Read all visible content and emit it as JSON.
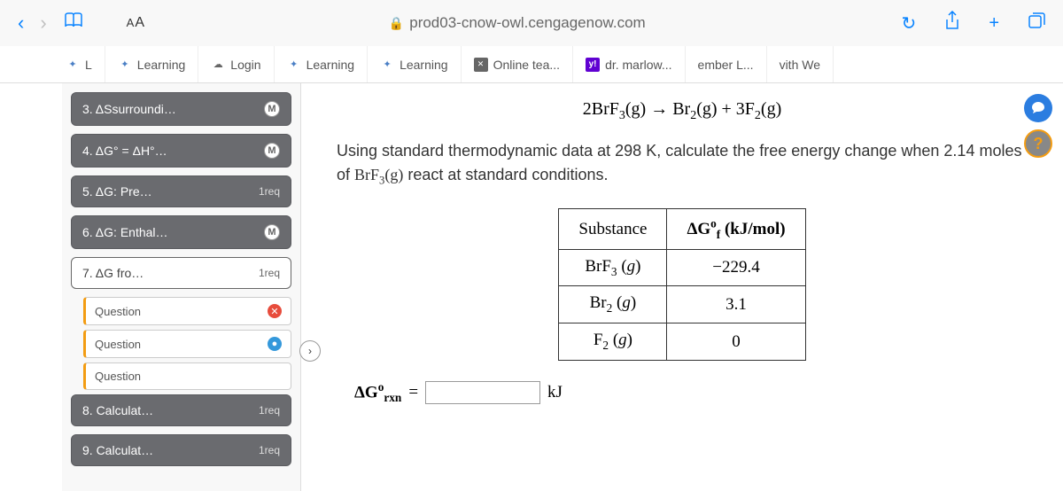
{
  "browser": {
    "url": "prod03-cnow-owl.cengagenow.com",
    "textSize": "AA"
  },
  "tabs": [
    {
      "label": "L",
      "fav": "owl"
    },
    {
      "label": "Learning",
      "fav": "owl"
    },
    {
      "label": "Login",
      "fav": "cloud"
    },
    {
      "label": "Learning",
      "fav": "owl"
    },
    {
      "label": "Learning",
      "fav": "owl"
    },
    {
      "label": "Online tea...",
      "fav": "x"
    },
    {
      "label": "dr. marlow...",
      "fav": "y"
    },
    {
      "label": "ember L...",
      "fav": ""
    },
    {
      "label": "vith We",
      "fav": ""
    }
  ],
  "sidebar": {
    "items": [
      {
        "label": "3. ΔSsurroundi…",
        "badge": "M",
        "style": "dark"
      },
      {
        "label": "4. ΔG° = ΔH°…",
        "badge": "M",
        "style": "dark"
      },
      {
        "label": "5. ΔG: Pre…",
        "badge": "1req",
        "style": "dark"
      },
      {
        "label": "6. ΔG: Enthal…",
        "badge": "M",
        "style": "dark"
      },
      {
        "label": "7. ΔG fro…",
        "badge": "1req",
        "style": "current"
      },
      {
        "label": "8. Calculat…",
        "badge": "1req",
        "style": "dark"
      },
      {
        "label": "9. Calculat…",
        "badge": "1req",
        "style": "dark"
      }
    ],
    "subItems": [
      {
        "label": "Question",
        "badge": "red"
      },
      {
        "label": "Question",
        "badge": "blue"
      },
      {
        "label": "Question",
        "badge": ""
      }
    ]
  },
  "problem": {
    "equationParts": {
      "lhs_coef": "2",
      "lhs_species": "BrF",
      "lhs_sub": "3",
      "arrow": "→",
      "rhs1_species": "Br",
      "rhs1_sub": "2",
      "plus": "+",
      "rhs2_coef": "3",
      "rhs2_species": "F",
      "rhs2_sub": "2",
      "phase": "(g)"
    },
    "textBefore": "Using standard thermodynamic data at 298 K, calculate the free energy change when 2.14 moles of ",
    "textSpecies": "BrF",
    "textSpeciesSub": "3",
    "textPhase": "(g)",
    "textAfter": " react at standard conditions.",
    "tableHeaders": {
      "substance": "Substance",
      "deltaG": "ΔG",
      "deltaGSup": "o",
      "deltaGSub": "f",
      "units": "(kJ/mol)"
    },
    "answerLabel": {
      "symbol": "ΔG",
      "sup": "o",
      "sub": "rxn",
      "equals": "=",
      "unit": "kJ"
    }
  },
  "chart_data": {
    "type": "table",
    "title": "Standard Gibbs free energy of formation",
    "columns": [
      "Substance",
      "ΔG°f (kJ/mol)"
    ],
    "rows": [
      {
        "substance": "BrF3 (g)",
        "value": -229.4
      },
      {
        "substance": "Br2 (g)",
        "value": 3.1
      },
      {
        "substance": "F2 (g)",
        "value": 0.0
      }
    ]
  }
}
